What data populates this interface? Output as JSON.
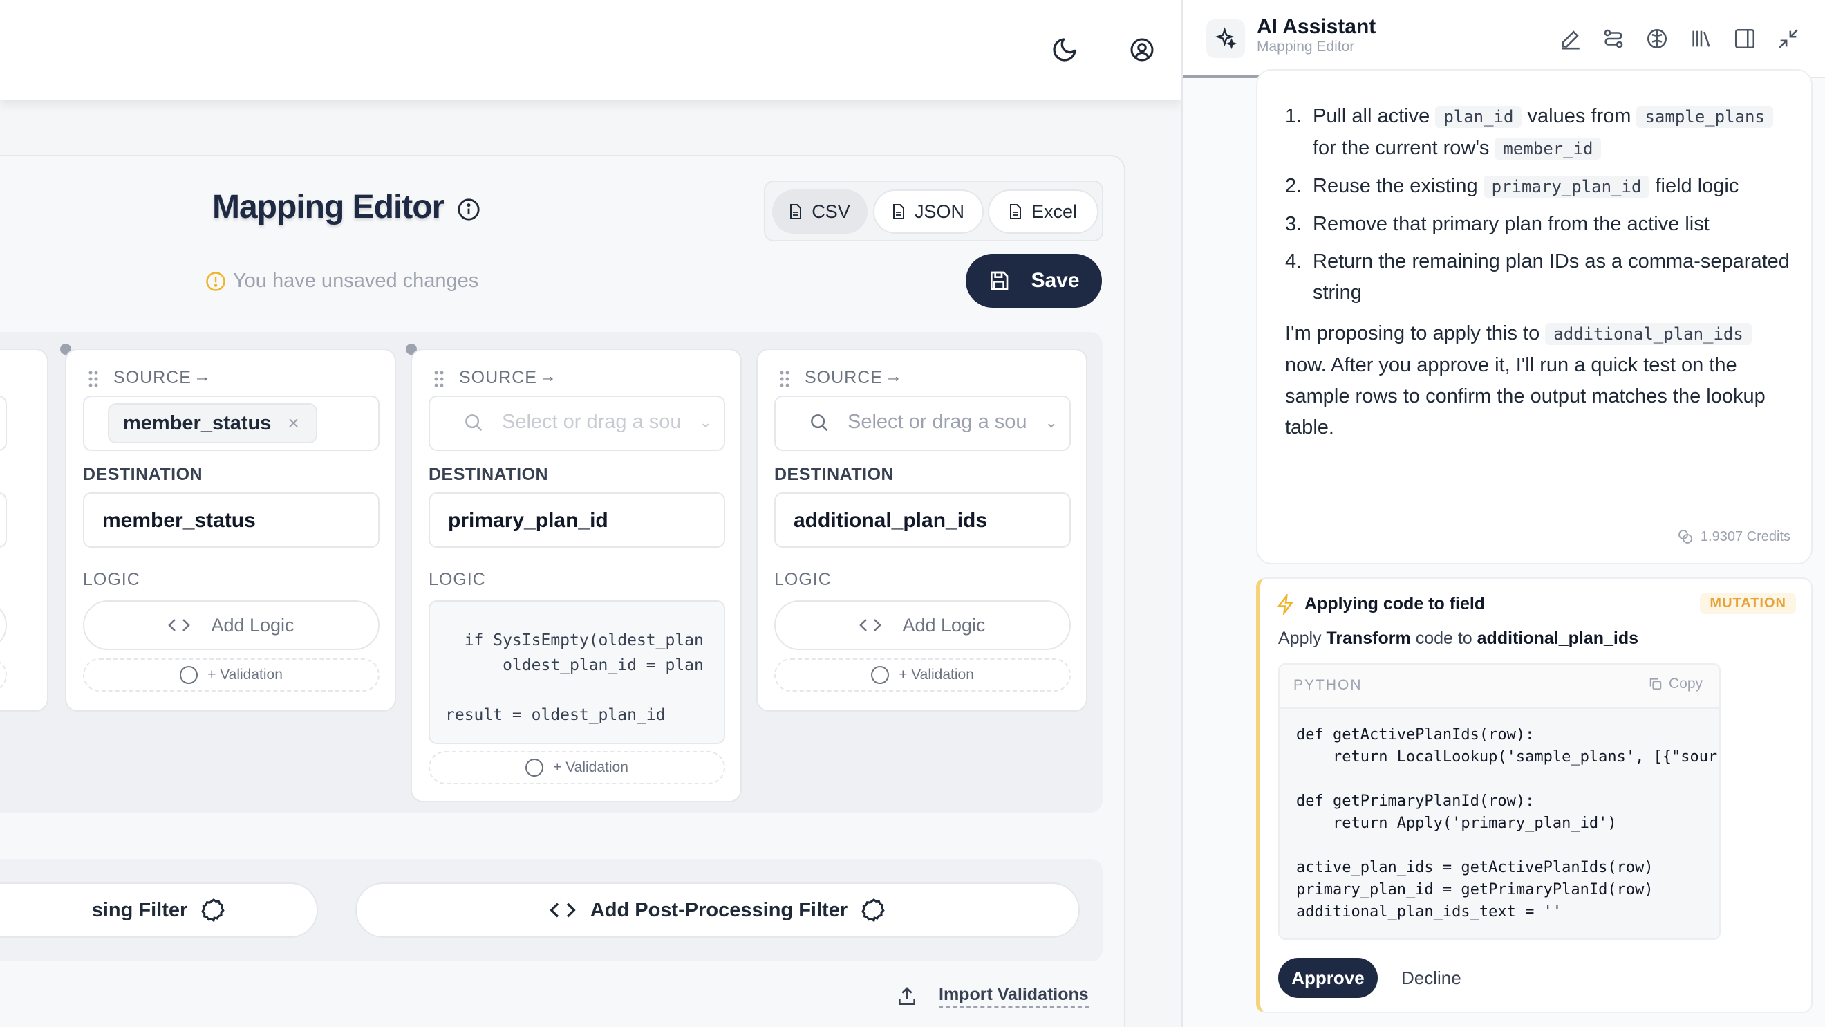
{
  "topbar": {
    "theme_icon": "moon-icon",
    "account_icon": "user-circle-icon"
  },
  "editor": {
    "title": "Mapping Editor",
    "formats": [
      {
        "label": "CSV"
      },
      {
        "label": "JSON"
      },
      {
        "label": "Excel"
      }
    ],
    "unsaved_text": "You have unsaved changes",
    "save_label": "Save"
  },
  "cards": [
    {
      "source_label": "SOURCE",
      "source_chip": "member_status",
      "destination_label": "DESTINATION",
      "destination_value": "member_status",
      "logic_label": "LOGIC",
      "add_logic_label": "Add Logic",
      "validation_label": "+ Validation"
    },
    {
      "source_label": "SOURCE",
      "source_placeholder": "Select or drag a sou",
      "destination_label": "DESTINATION",
      "destination_value": "primary_plan_id",
      "logic_label": "LOGIC",
      "logic_code": "  if SysIsEmpty(oldest_plan\n      oldest_plan_id = plan\n\nresult = oldest_plan_id",
      "validation_label": "+ Validation"
    },
    {
      "source_label": "SOURCE",
      "source_placeholder": "Select or drag a sou",
      "destination_label": "DESTINATION",
      "destination_value": "additional_plan_ids",
      "logic_label": "LOGIC",
      "add_logic_label": "Add Logic",
      "validation_label": "+ Validation"
    }
  ],
  "filters": {
    "pre_label": "sing Filter",
    "post_label": "Add Post-Processing Filter"
  },
  "import_label": "Import Validations",
  "assistant": {
    "title": "AI Assistant",
    "subtitle": "Mapping Editor",
    "steps": [
      {
        "n": "1.",
        "parts": [
          "Pull all active ",
          "plan_id",
          " values from ",
          "sample_plans",
          " for the current row's ",
          "member_id",
          ""
        ]
      },
      {
        "n": "2.",
        "parts": [
          "Reuse the existing ",
          "primary_plan_id",
          " field logic"
        ]
      },
      {
        "n": "3.",
        "parts": [
          "Remove that primary plan from the active list"
        ]
      },
      {
        "n": "4.",
        "parts": [
          "Return the remaining plan IDs as a comma-separated string"
        ]
      }
    ],
    "para_a": "I'm proposing to apply this to ",
    "para_code": "additional_plan_ids",
    "para_b": " now. After you approve it, I'll run a quick test on the sample rows to confirm the output matches the lookup table.",
    "credits": "1.9307 Credits",
    "mutation": {
      "title": "Applying code to field",
      "badge": "MUTATION",
      "desc_a": "Apply ",
      "desc_b": "Transform",
      "desc_c": " code to ",
      "desc_d": "additional_plan_ids",
      "lang": "PYTHON",
      "copy": "Copy",
      "code": "def getActivePlanIds(row):\n    return LocalLookup('sample_plans', [{\"sour\n\ndef getPrimaryPlanId(row):\n    return Apply('primary_plan_id')\n\nactive_plan_ids = getActivePlanIds(row)\nprimary_plan_id = getPrimaryPlanId(row)\nadditional_plan_ids_text = ''",
      "approve": "Approve",
      "decline": "Decline"
    }
  }
}
